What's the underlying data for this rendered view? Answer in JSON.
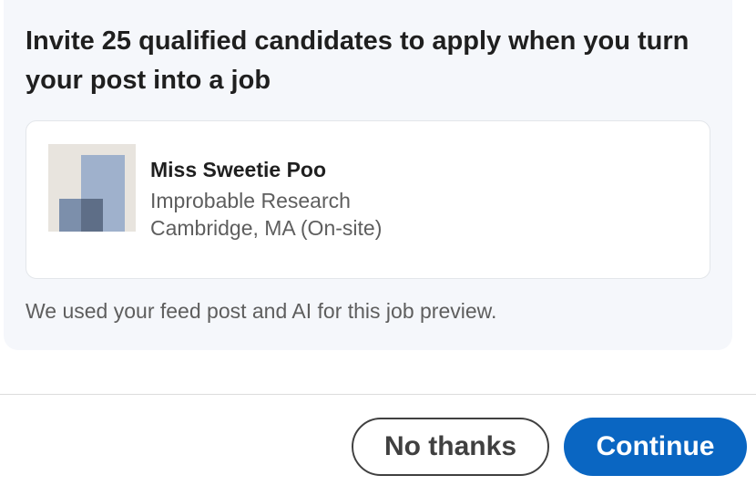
{
  "dialog": {
    "title": "Invite 25 qualified candidates to apply when you turn your post into a job"
  },
  "job_preview": {
    "job_title": "Miss Sweetie Poo",
    "company": "Improbable Research",
    "location": "Cambridge, MA (On-site)",
    "logo_icon": "company-logo-placeholder-icon"
  },
  "note": "We used your feed post and AI for this job preview.",
  "footer": {
    "no_thanks_label": "No thanks",
    "continue_label": "Continue"
  },
  "colors": {
    "primary": "#0a66c2",
    "card_background": "#f5f7fb",
    "text_primary": "#1f1f1f",
    "text_secondary": "#5e5e5e"
  }
}
